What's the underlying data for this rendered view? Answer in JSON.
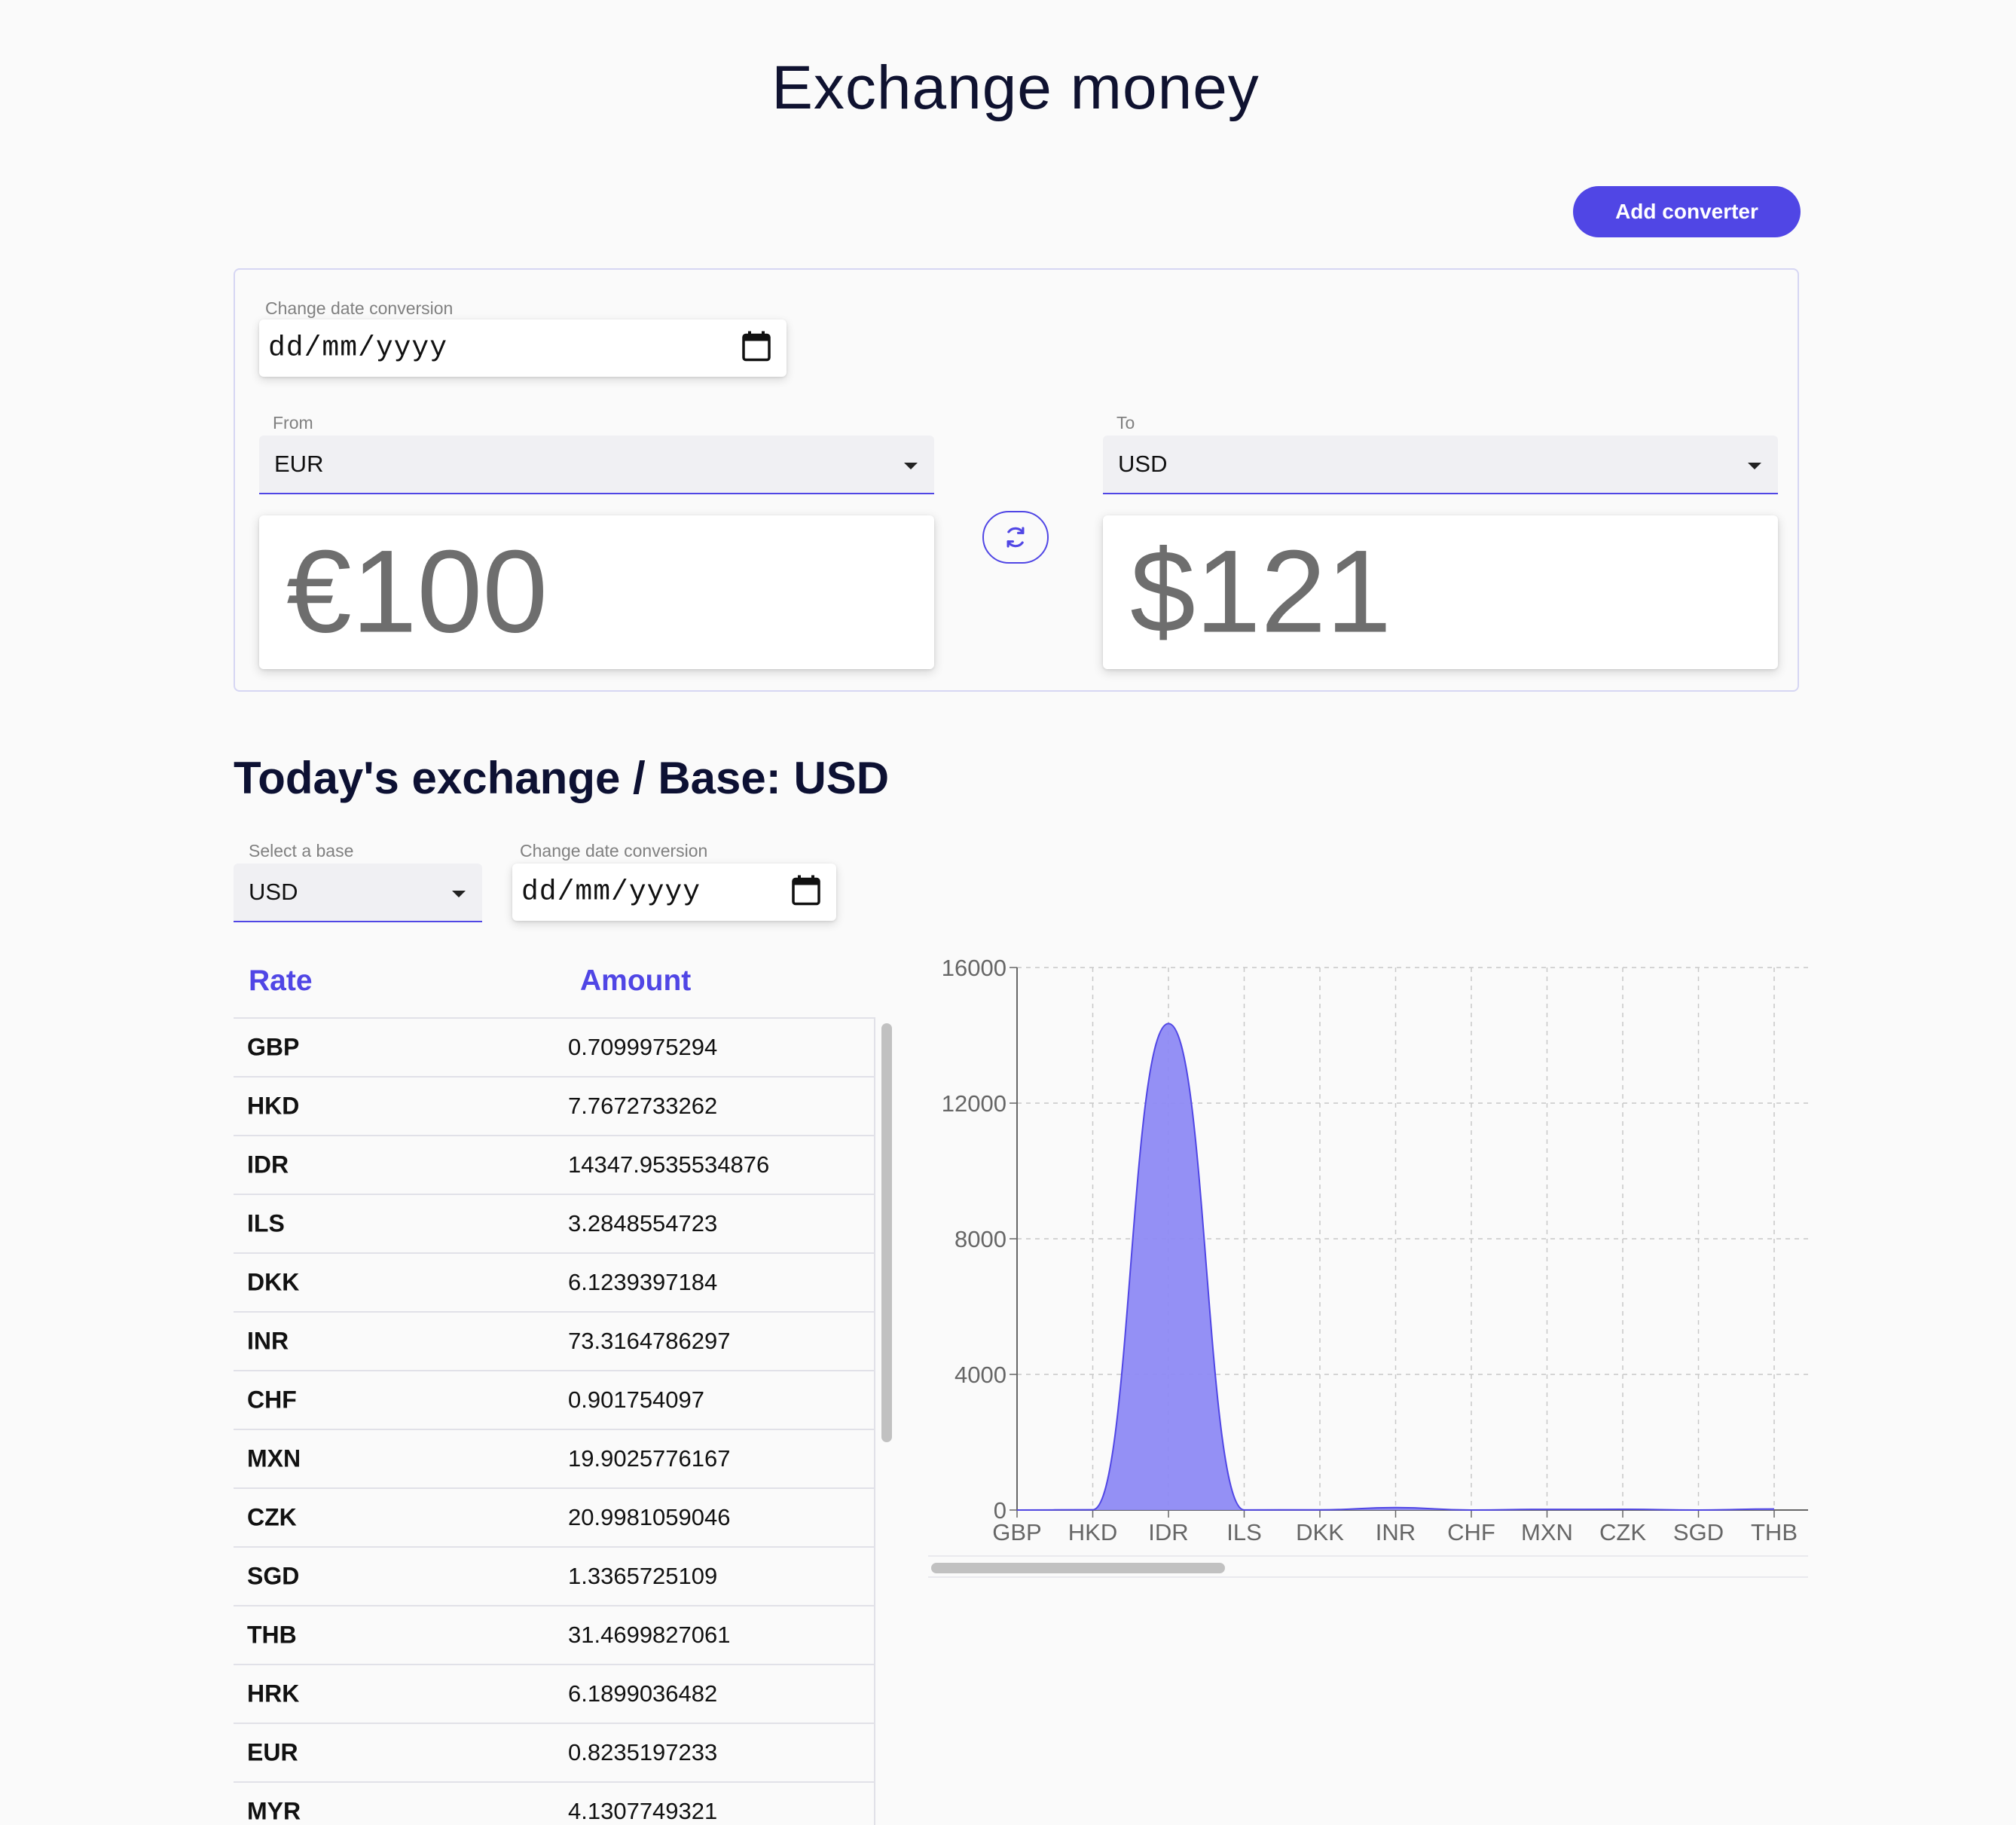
{
  "header": {
    "title": "Exchange money",
    "add_converter_label": "Add converter"
  },
  "converter": {
    "date_label": "Change date conversion",
    "date_placeholder": "dd/mm/yyyy",
    "from_label": "From",
    "from_value": "EUR",
    "to_label": "To",
    "to_value": "USD",
    "from_amount": "€100",
    "to_amount": "$121",
    "swap_icon": "swap-arrows-icon"
  },
  "exchange": {
    "title": "Today's exchange / Base: USD",
    "base_label": "Select a base",
    "base_value": "USD",
    "date_label": "Change date conversion",
    "date_placeholder": "dd/mm/yyyy",
    "col_rate": "Rate",
    "col_amount": "Amount",
    "rows": [
      {
        "code": "GBP",
        "value": "0.7099975294"
      },
      {
        "code": "HKD",
        "value": "7.7672733262"
      },
      {
        "code": "IDR",
        "value": "14347.9535534876"
      },
      {
        "code": "ILS",
        "value": "3.2848554723"
      },
      {
        "code": "DKK",
        "value": "6.1239397184"
      },
      {
        "code": "INR",
        "value": "73.3164786297"
      },
      {
        "code": "CHF",
        "value": "0.901754097"
      },
      {
        "code": "MXN",
        "value": "19.9025776167"
      },
      {
        "code": "CZK",
        "value": "20.9981059046"
      },
      {
        "code": "SGD",
        "value": "1.3365725109"
      },
      {
        "code": "THB",
        "value": "31.4699827061"
      },
      {
        "code": "HRK",
        "value": "6.1899036482"
      },
      {
        "code": "EUR",
        "value": "0.8235197233"
      },
      {
        "code": "MYR",
        "value": "4.1307749321"
      }
    ]
  },
  "chart_data": {
    "type": "area",
    "categories": [
      "GBP",
      "HKD",
      "IDR",
      "ILS",
      "DKK",
      "INR",
      "CHF",
      "MXN",
      "CZK",
      "SGD",
      "THB"
    ],
    "values": [
      0.7099975294,
      7.7672733262,
      14347.9535534876,
      3.2848554723,
      6.1239397184,
      73.3164786297,
      0.901754097,
      19.9025776167,
      20.9981059046,
      1.3365725109,
      31.4699827061
    ],
    "ylim": [
      0,
      16000
    ],
    "yticks": [
      "0",
      "4000",
      "8000",
      "12000",
      "16000"
    ],
    "grid": true,
    "fill_color": "#8e8af4",
    "stroke_color": "#5046e5"
  }
}
